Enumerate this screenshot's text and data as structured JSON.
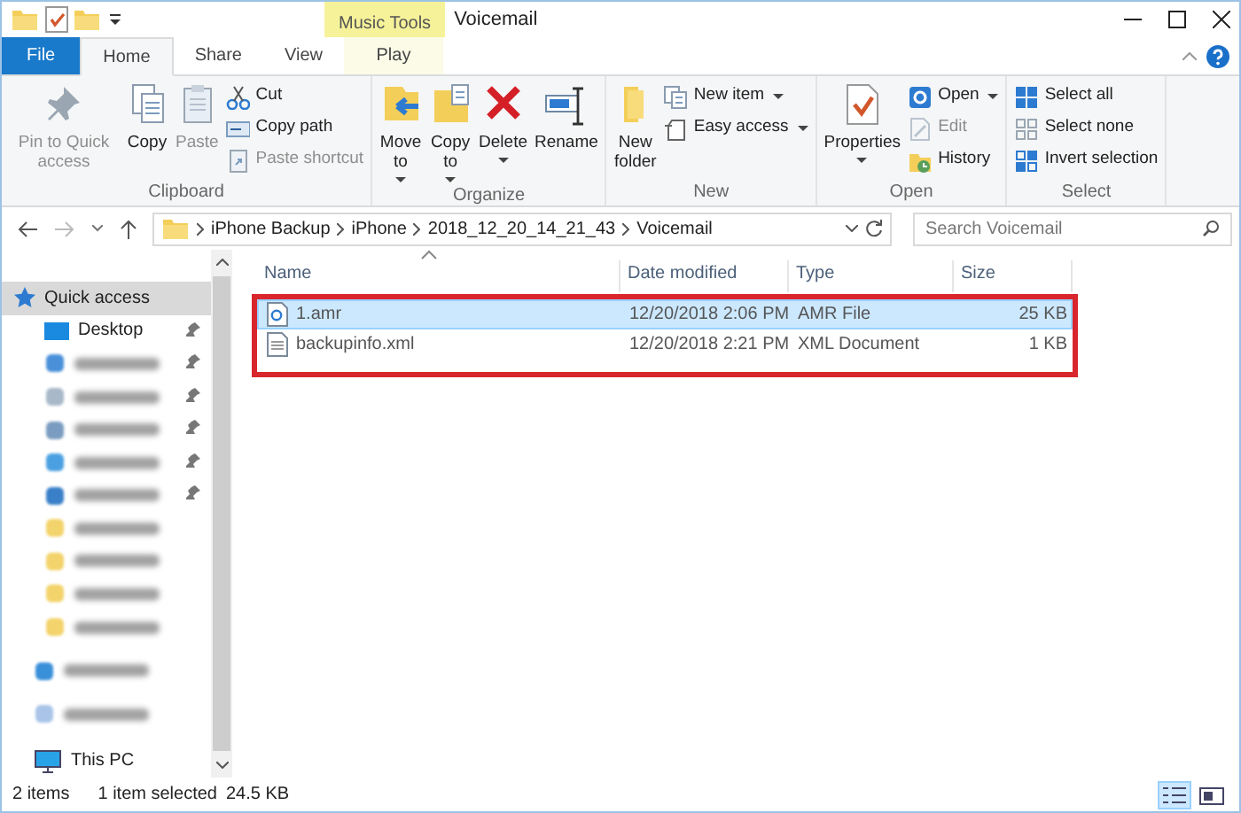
{
  "window": {
    "title": "Voicemail",
    "context_group": "Music Tools"
  },
  "tabs": [
    {
      "label": "File",
      "kind": "file",
      "selected": false
    },
    {
      "label": "Home",
      "kind": "normal",
      "selected": true
    },
    {
      "label": "Share",
      "kind": "normal",
      "selected": false
    },
    {
      "label": "View",
      "kind": "normal",
      "selected": false
    },
    {
      "label": "Play",
      "kind": "context",
      "selected": false
    }
  ],
  "ribbon": {
    "groups": [
      {
        "label": "Clipboard",
        "large": [
          {
            "label": "Pin to Quick access",
            "disabled": true,
            "dropdown": false
          },
          {
            "label": "Copy",
            "disabled": false,
            "dropdown": false
          },
          {
            "label": "Paste",
            "disabled": true,
            "dropdown": false
          }
        ],
        "small": [
          {
            "label": "Cut",
            "disabled": false,
            "dropdown": false
          },
          {
            "label": "Copy path",
            "disabled": false,
            "dropdown": false
          },
          {
            "label": "Paste shortcut",
            "disabled": true,
            "dropdown": false
          }
        ]
      },
      {
        "label": "Organize",
        "large": [
          {
            "label": "Move to",
            "disabled": false,
            "dropdown": true
          },
          {
            "label": "Copy to",
            "disabled": false,
            "dropdown": true
          },
          {
            "label": "Delete",
            "disabled": false,
            "dropdown": true
          },
          {
            "label": "Rename",
            "disabled": false,
            "dropdown": false
          }
        ]
      },
      {
        "label": "New",
        "large": [
          {
            "label": "New folder",
            "disabled": false,
            "dropdown": false
          }
        ],
        "small": [
          {
            "label": "New item",
            "disabled": false,
            "dropdown": true
          },
          {
            "label": "Easy access",
            "disabled": false,
            "dropdown": true
          }
        ]
      },
      {
        "label": "Open",
        "large": [
          {
            "label": "Properties",
            "disabled": false,
            "dropdown": true
          }
        ],
        "small": [
          {
            "label": "Open",
            "disabled": false,
            "dropdown": true
          },
          {
            "label": "Edit",
            "disabled": true,
            "dropdown": false
          },
          {
            "label": "History",
            "disabled": false,
            "dropdown": false
          }
        ]
      },
      {
        "label": "Select",
        "small": [
          {
            "label": "Select all",
            "disabled": false,
            "dropdown": false
          },
          {
            "label": "Select none",
            "disabled": false,
            "dropdown": false
          },
          {
            "label": "Invert selection",
            "disabled": false,
            "dropdown": false
          }
        ]
      }
    ]
  },
  "address": {
    "path": [
      "iPhone Backup",
      "iPhone",
      "2018_12_20_14_21_43",
      "Voicemail"
    ],
    "search_placeholder": "Search Voicemail"
  },
  "nav": {
    "items": [
      {
        "label": "Quick access",
        "kind": "quick",
        "selected": true,
        "pinned": false
      },
      {
        "label": "Desktop",
        "kind": "desktop",
        "selected": false,
        "pinned": true
      },
      {
        "kind": "blurred",
        "color": "#4a90d9",
        "selected": false,
        "pinned": true
      },
      {
        "kind": "blurred",
        "color": "#a8b8c8",
        "selected": false,
        "pinned": true
      },
      {
        "kind": "blurred",
        "color": "#7a9cc0",
        "selected": false,
        "pinned": true
      },
      {
        "kind": "blurred",
        "color": "#4aa0e0",
        "selected": false,
        "pinned": true
      },
      {
        "kind": "blurred",
        "color": "#3a80c8",
        "selected": false,
        "pinned": true
      },
      {
        "kind": "blurred",
        "color": "#f3d36b",
        "selected": false,
        "pinned": false
      },
      {
        "kind": "blurred",
        "color": "#f3d36b",
        "selected": false,
        "pinned": false
      },
      {
        "kind": "blurred",
        "color": "#f3d36b",
        "selected": false,
        "pinned": false
      },
      {
        "kind": "blurred",
        "color": "#f3d36b",
        "selected": false,
        "pinned": false
      },
      {
        "kind": "blurred-root",
        "color": "#3a8fd9",
        "selected": false,
        "pinned": false
      },
      {
        "kind": "blurred-root",
        "color": "#a9c4e8",
        "selected": false,
        "pinned": false
      },
      {
        "label": "This PC",
        "kind": "pc",
        "selected": false,
        "pinned": false
      }
    ]
  },
  "files": {
    "highlight": true,
    "columns": [
      {
        "label": "Name",
        "sorted": true
      },
      {
        "label": "Date modified",
        "sorted": false
      },
      {
        "label": "Type",
        "sorted": false
      },
      {
        "label": "Size",
        "sorted": false
      }
    ],
    "rows": [
      {
        "kind": "audio",
        "name": "1.amr",
        "date": "12/20/2018 2:06 PM",
        "type": "AMR File",
        "size": "25 KB",
        "selected": true
      },
      {
        "kind": "xml",
        "name": "backupinfo.xml",
        "date": "12/20/2018 2:21 PM",
        "type": "XML Document",
        "size": "1 KB",
        "selected": false
      }
    ]
  },
  "status_bar": {
    "count": "2 items",
    "selection": "1 item selected",
    "selection_size": "24.5 KB",
    "views": [
      {
        "selected": true
      },
      {
        "selected": false
      }
    ]
  }
}
